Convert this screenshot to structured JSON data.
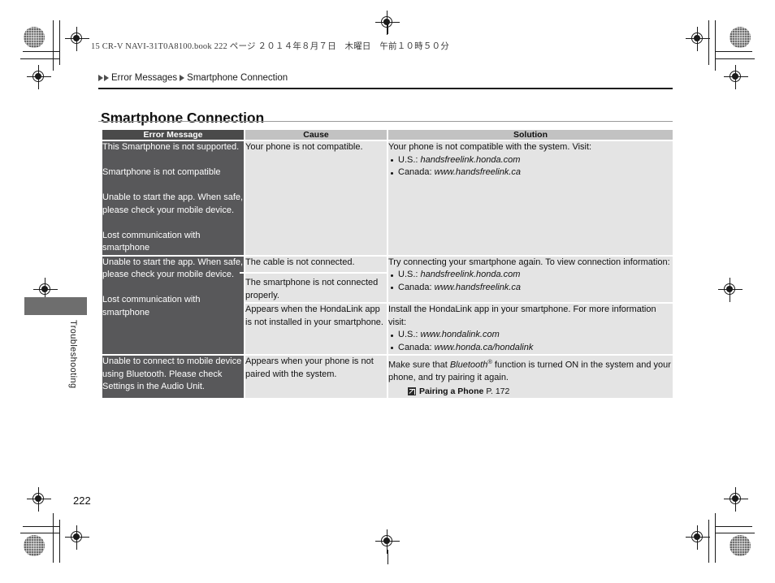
{
  "slug": {
    "text": "15 CR-V NAVI-31T0A8100.book   222 ページ   ２０１４年８月７日　木曜日　午前１０時５０分"
  },
  "breadcrumb": {
    "parent": "Error Messages",
    "current": "Smartphone Connection"
  },
  "page_title": "Smartphone Connection",
  "side_tab_label": "Troubleshooting",
  "folio": "222",
  "table": {
    "headers": {
      "error_message": "Error Message",
      "cause": "Cause",
      "solution": "Solution"
    },
    "rows": [
      {
        "error_message_lines": [
          "This Smartphone is not supported.",
          "",
          "Smartphone is not compatible",
          "",
          "Unable to start the app. When safe, please check your mobile device.",
          "",
          "Lost communication with smartphone"
        ],
        "causes": [
          "Your phone is not compatible."
        ],
        "solution": {
          "intro": "Your phone is not compatible with the system. Visit:",
          "bullets": [
            {
              "label": "U.S.: ",
              "url": "handsfreelink.honda.com"
            },
            {
              "label": "Canada: ",
              "url": "www.handsfreelink.ca"
            }
          ]
        }
      },
      {
        "error_message_lines": [
          "Unable to start the app. When safe, please check your mobile device.",
          "",
          "Lost communication with smartphone"
        ],
        "sub_blocks": [
          {
            "causes": [
              "The cable is not connected.",
              "The smartphone is not connected properly."
            ],
            "solution": {
              "intro": "Try connecting your smartphone again. To view connection information:",
              "bullets": [
                {
                  "label": "U.S.: ",
                  "url": "handsfreelink.honda.com"
                },
                {
                  "label": "Canada: ",
                  "url": "www.handsfreelink.ca"
                }
              ]
            }
          },
          {
            "causes": [
              "Appears when the HondaLink app is not installed in your smartphone."
            ],
            "solution": {
              "intro": "Install the HondaLink app in your smartphone. For more information visit:",
              "bullets": [
                {
                  "label": "U.S.: ",
                  "url": "www.hondalink.com"
                },
                {
                  "label": "Canada: ",
                  "url": "www.honda.ca/hondalink"
                }
              ]
            }
          }
        ]
      },
      {
        "error_message_lines": [
          "Unable to connect to mobile device using Bluetooth. Please check Settings in the Audio Unit."
        ],
        "causes": [
          "Appears when your phone is not paired with the system."
        ],
        "solution": {
          "intro_part1": "Make sure that ",
          "intro_italic": "Bluetooth",
          "intro_sup": "®",
          "intro_part2": " function is turned ON in the system and your phone, and try pairing it again.",
          "reference": {
            "icon": "jump-reference-icon",
            "title": "Pairing a Phone",
            "page": "P. 172"
          }
        }
      }
    ]
  },
  "colors": {
    "header_dark": "#4a4a4a",
    "header_light": "#c2c2c2",
    "cell_dark": "#58585a",
    "cell_light": "#e4e4e4",
    "tab_gray": "#6e6e6e"
  }
}
